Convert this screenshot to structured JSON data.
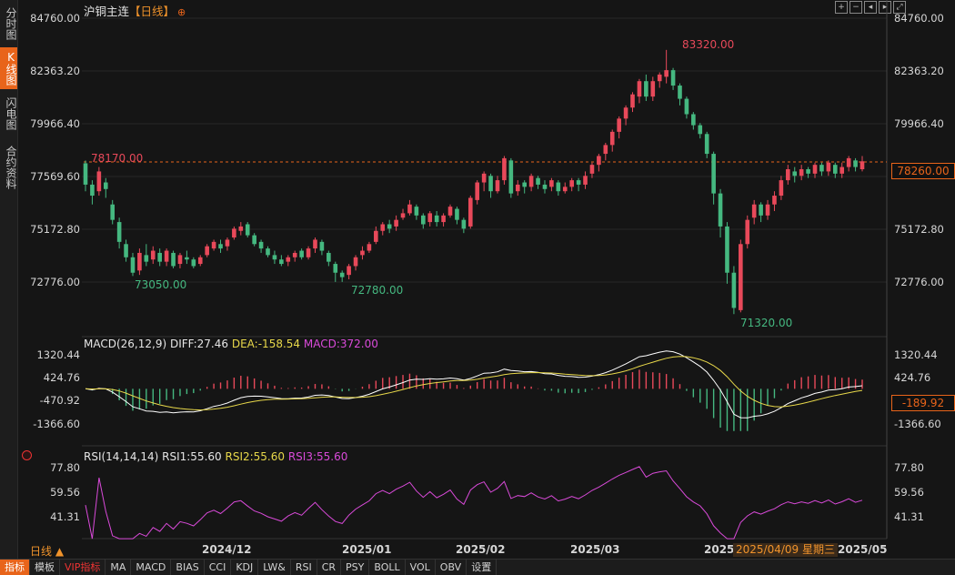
{
  "sidebar": {
    "tabs": [
      {
        "label": "分时图",
        "active": false
      },
      {
        "label": "K线图",
        "active": true
      },
      {
        "label": "闪电图",
        "active": false
      },
      {
        "label": "合约资料",
        "active": false
      }
    ]
  },
  "header": {
    "symbol": "沪铜主连",
    "period": "【日线】",
    "pin_icon": "⊕"
  },
  "toolbar_icons": [
    "expand-icon",
    "shrink-icon",
    "prev-icon",
    "next-icon",
    "fullscreen-icon"
  ],
  "price_axis": {
    "left_ticks": [
      "84760.00",
      "82363.20",
      "79966.40",
      "77569.60",
      "75172.80",
      "72776.00"
    ],
    "right_ticks": [
      "84760.00",
      "82363.20",
      "79966.40",
      "77569.60",
      "75172.80",
      "72776.00"
    ],
    "current_price": "78260.00",
    "marked_price": "78170.00",
    "high_label": "83320.00",
    "low_labels": [
      "73050.00",
      "72780.00",
      "71320.00"
    ]
  },
  "macd": {
    "legend_name": "MACD(26,12,9)",
    "diff": "DIFF:27.46",
    "dea": "DEA:-158.54",
    "macd": "MACD:372.00",
    "ticks": [
      "1320.44",
      "424.76",
      "-470.92",
      "-1366.60"
    ],
    "right_ticks": [
      "1320.44",
      "424.76",
      "-1366.60"
    ],
    "current": "-189.92"
  },
  "rsi": {
    "legend_name": "RSI(14,14,14)",
    "rsi1": "RSI1:55.60",
    "rsi2": "RSI2:55.60",
    "rsi3": "RSI3:55.60",
    "ticks": [
      "77.80",
      "59.56",
      "41.31"
    ]
  },
  "time_axis": {
    "labels": [
      "2024/12",
      "2025/01",
      "2025/02",
      "2025/03",
      "2025/",
      "2025/05"
    ],
    "cursor_date": "2025/04/09 星期三"
  },
  "period_select": "日线 ▲",
  "bottom_bar": [
    "指标",
    "模板",
    "VIP指标",
    "MA",
    "MACD",
    "BIAS",
    "CCI",
    "KDJ",
    "LW&",
    "RSI",
    "CR",
    "PSY",
    "BOLL",
    "VOL",
    "OBV",
    "设置"
  ],
  "colors": {
    "up": "#e8495a",
    "down": "#45b880",
    "accent": "#e8641a",
    "diff": "#ffffff",
    "dea": "#e8d84a",
    "macd": "#d94ad9",
    "rsi": "#d94ad9"
  },
  "chart_data": {
    "type": "candlestick",
    "ylim": [
      71000,
      84760
    ],
    "candles": [
      [
        78170,
        77200,
        78300,
        76900
      ],
      [
        77200,
        76700,
        77400,
        76300
      ],
      [
        76900,
        77800,
        78000,
        76700
      ],
      [
        77300,
        77000,
        77500,
        76600
      ],
      [
        76300,
        75600,
        76500,
        75400
      ],
      [
        75500,
        74600,
        75700,
        74300
      ],
      [
        74500,
        73900,
        74700,
        73700
      ],
      [
        73900,
        73200,
        74100,
        73050
      ],
      [
        73300,
        74100,
        74300,
        73100
      ],
      [
        74000,
        73700,
        74500,
        73500
      ],
      [
        73800,
        74200,
        74400,
        73600
      ],
      [
        74100,
        73700,
        74300,
        73500
      ],
      [
        73700,
        74200,
        74300,
        73500
      ],
      [
        74100,
        73500,
        74200,
        73400
      ],
      [
        73600,
        74000,
        74100,
        73400
      ],
      [
        73900,
        73800,
        74200,
        73600
      ],
      [
        73800,
        73500,
        73900,
        73400
      ],
      [
        73600,
        73900,
        74000,
        73500
      ],
      [
        74000,
        74400,
        74500,
        73900
      ],
      [
        74300,
        74600,
        74700,
        74200
      ],
      [
        74500,
        74300,
        74700,
        74100
      ],
      [
        74400,
        74700,
        74800,
        74200
      ],
      [
        74800,
        75200,
        75300,
        74700
      ],
      [
        75100,
        75300,
        75500,
        74900
      ],
      [
        75400,
        74900,
        75500,
        74800
      ],
      [
        74900,
        74500,
        75000,
        74400
      ],
      [
        74600,
        74300,
        74700,
        74100
      ],
      [
        74300,
        74000,
        74400,
        73900
      ],
      [
        74000,
        73800,
        74200,
        73600
      ],
      [
        73800,
        73600,
        74000,
        73500
      ],
      [
        73700,
        73900,
        74000,
        73500
      ],
      [
        73900,
        74100,
        74200,
        73700
      ],
      [
        74200,
        73900,
        74300,
        73800
      ],
      [
        73900,
        74300,
        74400,
        73800
      ],
      [
        74300,
        74700,
        74800,
        74100
      ],
      [
        74600,
        74200,
        74700,
        74000
      ],
      [
        74100,
        73700,
        74200,
        73500
      ],
      [
        73600,
        73200,
        73700,
        72780
      ],
      [
        73200,
        73000,
        73300,
        72780
      ],
      [
        73100,
        73500,
        73600,
        72900
      ],
      [
        73500,
        73900,
        74000,
        73300
      ],
      [
        74000,
        74200,
        74400,
        73800
      ],
      [
        74200,
        74500,
        74600,
        74100
      ],
      [
        74600,
        75100,
        75300,
        74500
      ],
      [
        75100,
        75400,
        75500,
        74900
      ],
      [
        75400,
        75200,
        75600,
        75000
      ],
      [
        75300,
        75600,
        75800,
        75100
      ],
      [
        75700,
        75900,
        76100,
        75600
      ],
      [
        75900,
        76300,
        76500,
        75800
      ],
      [
        76200,
        75800,
        76300,
        75600
      ],
      [
        75800,
        75400,
        75900,
        75200
      ],
      [
        75500,
        75900,
        76000,
        75300
      ],
      [
        75800,
        75500,
        76000,
        75300
      ],
      [
        75500,
        75800,
        75900,
        75300
      ],
      [
        75800,
        76200,
        76300,
        75700
      ],
      [
        76100,
        75600,
        76200,
        75400
      ],
      [
        75600,
        75200,
        75700,
        75000
      ],
      [
        75300,
        76600,
        76700,
        75200
      ],
      [
        76500,
        77300,
        77400,
        76300
      ],
      [
        77300,
        77700,
        77800,
        76900
      ],
      [
        77600,
        76900,
        77700,
        76600
      ],
      [
        76900,
        77400,
        77600,
        76800
      ],
      [
        77400,
        78400,
        78500,
        77200
      ],
      [
        78300,
        76800,
        78400,
        76600
      ],
      [
        76900,
        77200,
        77400,
        76700
      ],
      [
        77300,
        77100,
        77400,
        76800
      ],
      [
        77100,
        77600,
        77700,
        76900
      ],
      [
        77500,
        77200,
        77600,
        77000
      ],
      [
        77200,
        77000,
        77400,
        76800
      ],
      [
        77100,
        77400,
        77500,
        76900
      ],
      [
        77300,
        76900,
        77400,
        76700
      ],
      [
        76900,
        77100,
        77300,
        76800
      ],
      [
        77100,
        77400,
        77500,
        76900
      ],
      [
        77400,
        77200,
        77500,
        76900
      ],
      [
        77200,
        77600,
        77800,
        77000
      ],
      [
        77700,
        78100,
        78200,
        77500
      ],
      [
        78100,
        78500,
        78600,
        77800
      ],
      [
        78600,
        79000,
        79100,
        78300
      ],
      [
        79000,
        79600,
        79700,
        78700
      ],
      [
        79600,
        80200,
        80300,
        79300
      ],
      [
        80200,
        80700,
        80800,
        79900
      ],
      [
        80700,
        81300,
        81400,
        80500
      ],
      [
        81200,
        81900,
        82000,
        80900
      ],
      [
        81900,
        81200,
        82200,
        81000
      ],
      [
        81200,
        81900,
        82100,
        81000
      ],
      [
        81900,
        82200,
        82300,
        81600
      ],
      [
        82100,
        82400,
        83320,
        81800
      ],
      [
        82400,
        81700,
        82500,
        81500
      ],
      [
        81700,
        81100,
        81800,
        80800
      ],
      [
        81100,
        80400,
        81200,
        80200
      ],
      [
        80400,
        79900,
        80500,
        79700
      ],
      [
        79900,
        79500,
        80000,
        79300
      ],
      [
        79500,
        78600,
        79600,
        78400
      ],
      [
        78600,
        76800,
        78700,
        76300
      ],
      [
        76800,
        75300,
        77000,
        74800
      ],
      [
        75300,
        73200,
        75500,
        72700
      ],
      [
        73200,
        71600,
        73500,
        71320
      ],
      [
        71500,
        74500,
        74700,
        71400
      ],
      [
        74500,
        75600,
        75800,
        74300
      ],
      [
        75700,
        76300,
        76500,
        75400
      ],
      [
        76300,
        75800,
        76400,
        75500
      ],
      [
        75800,
        76300,
        76500,
        75600
      ],
      [
        76300,
        76700,
        76900,
        76000
      ],
      [
        76700,
        77400,
        77600,
        76500
      ],
      [
        77400,
        77900,
        78100,
        77200
      ],
      [
        77800,
        77600,
        78000,
        77300
      ],
      [
        77600,
        77900,
        78100,
        77400
      ],
      [
        77900,
        77700,
        78000,
        77500
      ],
      [
        77700,
        78100,
        78200,
        77500
      ],
      [
        78100,
        77800,
        78200,
        77600
      ],
      [
        77800,
        78200,
        78300,
        77600
      ],
      [
        78100,
        77700,
        78200,
        77500
      ],
      [
        77700,
        78000,
        78200,
        77500
      ],
      [
        78000,
        78400,
        78500,
        77800
      ],
      [
        78300,
        78000,
        78400,
        77800
      ],
      [
        77900,
        78260,
        78500,
        77800
      ]
    ]
  }
}
